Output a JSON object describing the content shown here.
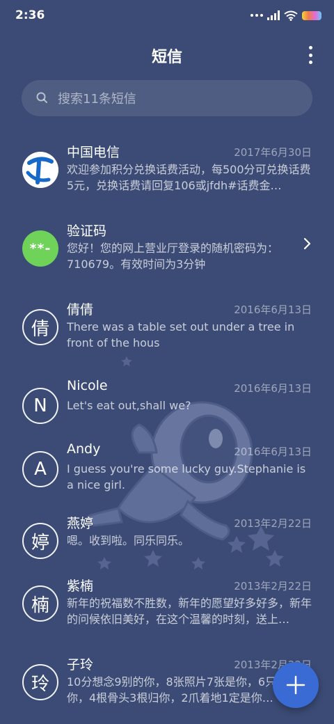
{
  "status_bar": {
    "time": "2:36"
  },
  "header": {
    "title": "短信"
  },
  "search": {
    "placeholder": "搜索11条短信"
  },
  "messages": [
    {
      "sender": "中国电信",
      "date": "2017年6月30日",
      "preview": "欢迎参加积分兑换话费活动，每500分可兑换话费5元，兑换话费请回复106或jfdh#话费金…",
      "avatar": "china-telecom-logo"
    },
    {
      "sender": "验证码",
      "date": "",
      "preview": "您好！您的网上营业厅登录的随机密码为：710679。有效时间为3分钟",
      "avatar_text": "**-"
    },
    {
      "sender": "倩倩",
      "date": "2016年6月13日",
      "preview": "There was a table set out under a tree in front of the hous",
      "avatar_text": "倩"
    },
    {
      "sender": "Nicole",
      "date": "2016年6月13日",
      "preview": "Let's eat out,shall we?",
      "avatar_text": "N"
    },
    {
      "sender": "Andy",
      "date": "2016年6月13日",
      "preview": "I guess you're some lucky guy.Stephanie is a nice girl.",
      "avatar_text": "A"
    },
    {
      "sender": "燕婷",
      "date": "2013年2月22日",
      "preview": "嗯。收到啦。同乐同乐。",
      "avatar_text": "婷"
    },
    {
      "sender": "紫楠",
      "date": "2013年2月22日",
      "preview": "新年的祝福数不胜数，新年的愿望好多好多，新年的问候依旧美好，在这个温馨的时刻，送上…",
      "avatar_text": "楠"
    },
    {
      "sender": "子玲",
      "date": "2013年2月22日",
      "preview": "10分想念9别的你，8张照片7张是你，6只…只像你，4根骨头3根归你，2爪着地1定是你…",
      "avatar_text": "玲"
    }
  ],
  "colors": {
    "background": "#3b4b75",
    "fab": "#3a6bd4",
    "verify_avatar": "#6fd35a"
  },
  "icons": {
    "search": "search-icon",
    "more": "more-vertical-icon",
    "chevron": "chevron-right-icon",
    "fab": "plus-icon"
  }
}
